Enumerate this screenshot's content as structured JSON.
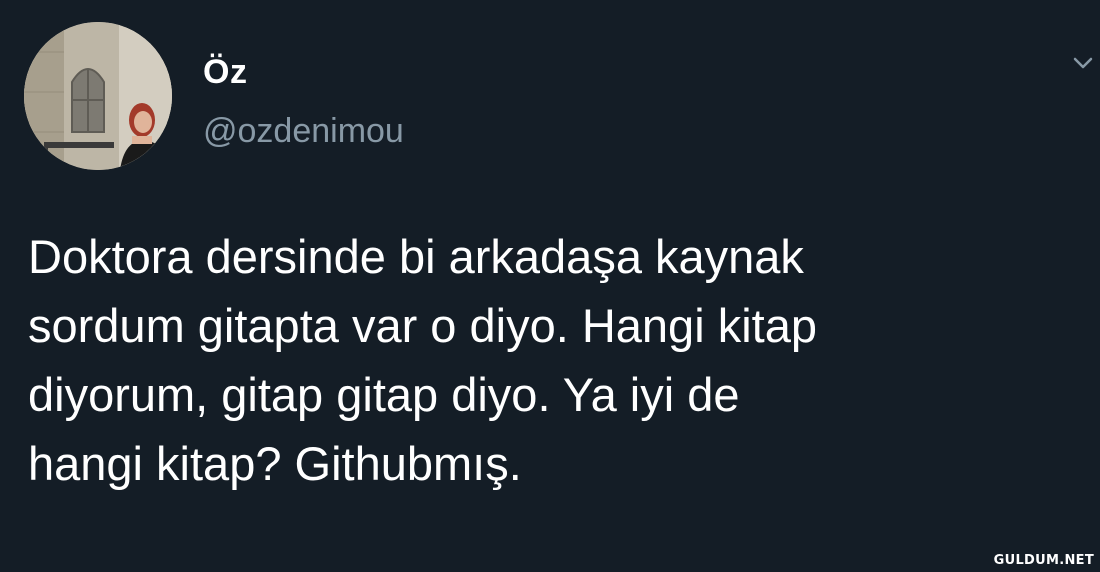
{
  "tweet": {
    "display_name": "Öz",
    "handle": "@ozdenimou",
    "text": "Doktora dersinde bi arkadaşa kaynak\nsordum gitapta var o diyo. Hangi kitap\ndiyorum, gitap gitap diyo. Ya iyi de\nhangi kitap? Githubmış.",
    "avatar_icon": "profile-photo",
    "menu_icon": "chevron-down-icon"
  },
  "watermark": "GULDUM.NET",
  "colors": {
    "background": "#141d26",
    "text_primary": "#ffffff",
    "text_secondary": "#8899a6"
  }
}
